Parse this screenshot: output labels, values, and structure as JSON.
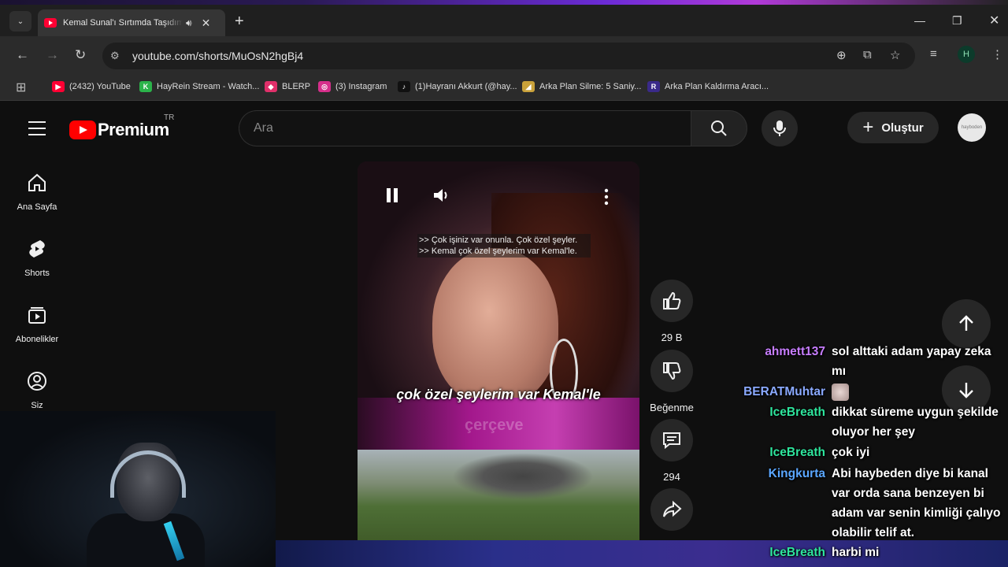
{
  "browser": {
    "tab_title": "Kemal Sunal'ı Sırtımda Taşıdım Perran Kutman",
    "url": "youtube.com/shorts/MuOsN2hgBj4",
    "profile_initial": "H",
    "bookmarks": [
      {
        "label": "(2432) YouTube",
        "color": "#ff0033",
        "glyph": "▶"
      },
      {
        "label": "HayRein Stream - Watch...",
        "color": "#2bb34a",
        "glyph": "K"
      },
      {
        "label": "BLERP",
        "color": "#e0306a",
        "glyph": "◆"
      },
      {
        "label": "(3) Instagram",
        "color": "#d62f8b",
        "glyph": "◎"
      },
      {
        "label": "(1)Hayranı Akkurt (@hay...",
        "color": "#111111",
        "glyph": "♪"
      },
      {
        "label": "Arka Plan Silme: 5 Saniy...",
        "color": "#c9a13a",
        "glyph": "◢"
      },
      {
        "label": "Arka Plan Kaldırma Aracı...",
        "color": "#3a2a8a",
        "glyph": "R"
      }
    ]
  },
  "youtube": {
    "logo_text": "Premium",
    "region": "TR",
    "search_placeholder": "Ara",
    "create_label": "Oluştur",
    "user_avatar_text": "hayboden",
    "sidebar": [
      {
        "label": "Ana Sayfa",
        "icon": "home-icon"
      },
      {
        "label": "Shorts",
        "icon": "shorts-icon"
      },
      {
        "label": "Abonelikler",
        "icon": "subscriptions-icon"
      },
      {
        "label": "Siz",
        "icon": "account-icon"
      }
    ],
    "video": {
      "subtitle_line1": ">> Çok işiniz var onunla. Çok özel şeyler.",
      "subtitle_line2": ">> Kemal çok özel şeylerim var Kemal'le.",
      "burned_caption": "çok özel şeylerim var Kemal'le",
      "watermark": "çerçeve"
    },
    "actions": {
      "like_count": "29 B",
      "dislike_label": "Beğenme",
      "comment_count": "294"
    }
  },
  "chat": [
    {
      "user": "ahmett137",
      "color": "#c77dff",
      "text": "sol alttaki adam yapay zeka mı"
    },
    {
      "user": "BERATMuhtar",
      "color": "#8aa9ff",
      "text": "",
      "emote": "emote-icon"
    },
    {
      "user": "IceBreath",
      "color": "#2ee59d",
      "text": "dikkat süreme uygun şekilde oluyor her şey"
    },
    {
      "user": "IceBreath",
      "color": "#2ee59d",
      "text": "çok iyi"
    },
    {
      "user": "Kingkurta",
      "color": "#5aa6ff",
      "text": "Abi haybeden diye bi kanal var orda sana benzeyen bi adam var senin kimliği çalıyo olabilir telif at."
    },
    {
      "user": "IceBreath",
      "color": "#2ee59d",
      "text": "harbi mi"
    }
  ]
}
